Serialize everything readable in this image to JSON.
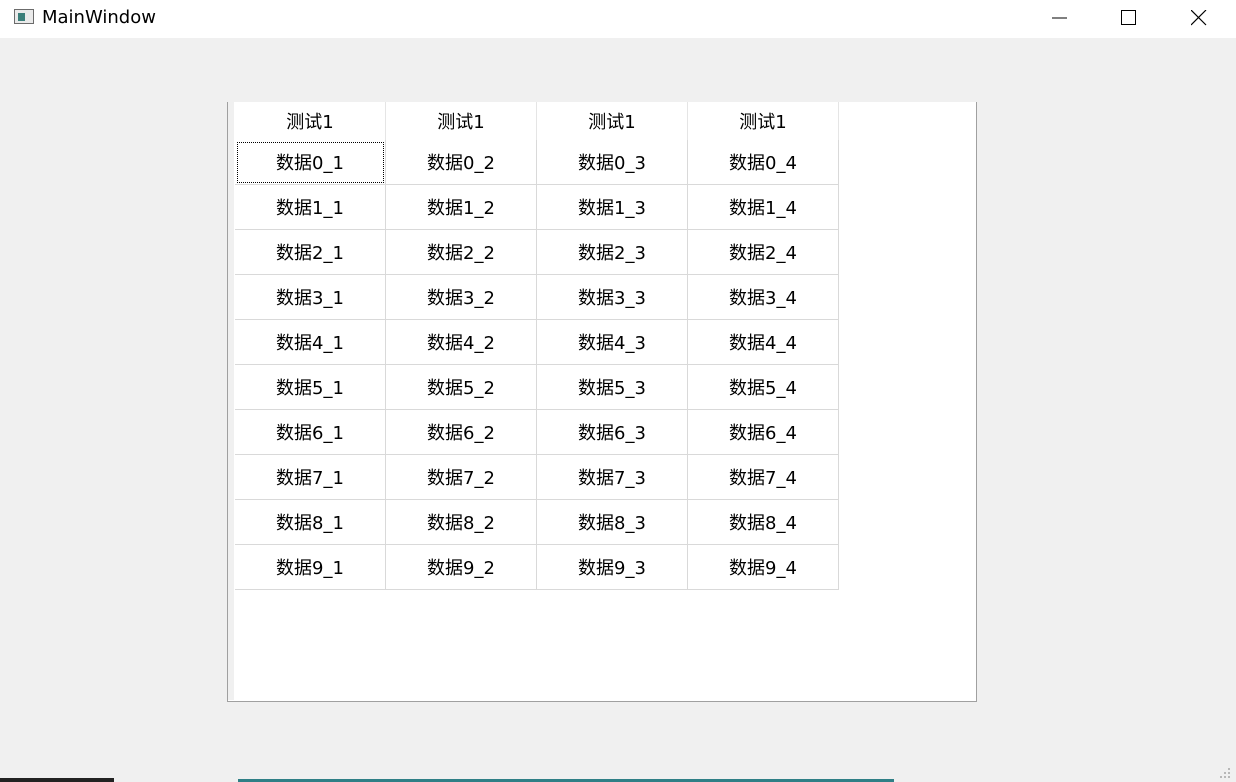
{
  "window": {
    "title": "MainWindow",
    "app_icon": "qt-window-icon",
    "controls": {
      "minimize": "minimize-icon",
      "maximize": "maximize-icon",
      "close": "close-icon"
    }
  },
  "table": {
    "headers": [
      "测试1",
      "测试1",
      "测试1",
      "测试1"
    ],
    "current_cell": [
      0,
      0
    ],
    "rows": [
      [
        "数据0_1",
        "数据0_2",
        "数据0_3",
        "数据0_4"
      ],
      [
        "数据1_1",
        "数据1_2",
        "数据1_3",
        "数据1_4"
      ],
      [
        "数据2_1",
        "数据2_2",
        "数据2_3",
        "数据2_4"
      ],
      [
        "数据3_1",
        "数据3_2",
        "数据3_3",
        "数据3_4"
      ],
      [
        "数据4_1",
        "数据4_2",
        "数据4_3",
        "数据4_4"
      ],
      [
        "数据5_1",
        "数据5_2",
        "数据5_3",
        "数据5_4"
      ],
      [
        "数据6_1",
        "数据6_2",
        "数据6_3",
        "数据6_4"
      ],
      [
        "数据7_1",
        "数据7_2",
        "数据7_3",
        "数据7_4"
      ],
      [
        "数据8_1",
        "数据8_2",
        "数据8_3",
        "数据8_4"
      ],
      [
        "数据9_1",
        "数据9_2",
        "数据9_3",
        "数据9_4"
      ]
    ]
  }
}
